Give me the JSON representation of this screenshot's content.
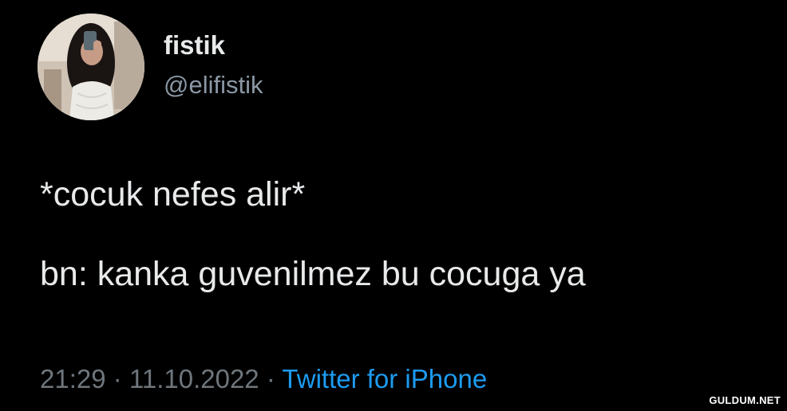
{
  "tweet": {
    "author": {
      "display_name": "fistik",
      "handle": "@elifistik",
      "avatar": "user-avatar-photo"
    },
    "text_lines": [
      "*cocuk nefes alir*",
      "bn: kanka guvenilmez bu cocuga ya"
    ],
    "meta": {
      "time": "21:29",
      "separator": "·",
      "date": "11.10.2022",
      "source": "Twitter for iPhone"
    }
  },
  "watermark": "GULDUM.NET",
  "colors": {
    "background": "#000000",
    "primary_text": "#e7e9ea",
    "secondary_text": "#8b98a5",
    "meta_text": "#6e767d",
    "link": "#1d9bf0"
  }
}
